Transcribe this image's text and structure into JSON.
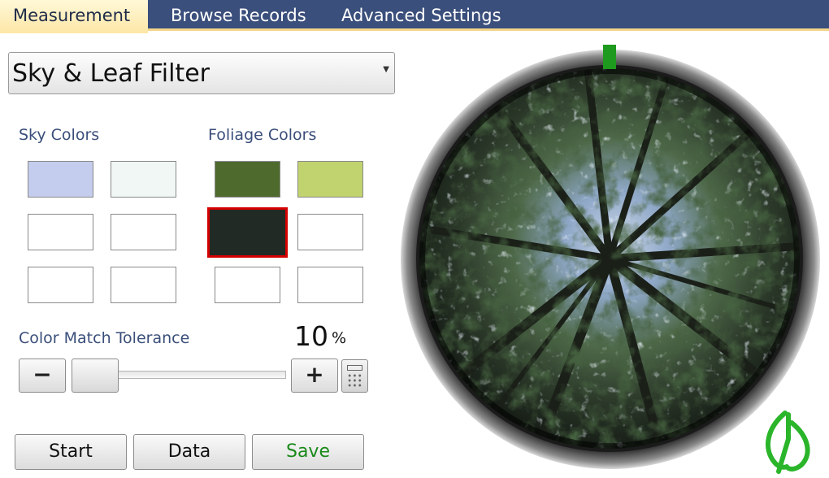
{
  "tabs": [
    {
      "label": "Measurement",
      "active": true
    },
    {
      "label": "Browse Records",
      "active": false
    },
    {
      "label": "Advanced Settings",
      "active": false
    }
  ],
  "filter": {
    "selected": "Sky & Leaf Filter"
  },
  "sky": {
    "label": "Sky Colors",
    "swatches": [
      "#c5cdee",
      "#f0f7f4",
      "#ffffff",
      "#ffffff",
      "#ffffff",
      "#ffffff"
    ]
  },
  "foliage": {
    "label": "Foliage Colors",
    "swatches": [
      "#4f6a2d",
      "#c0d36e",
      "#212a24",
      "#ffffff",
      "#ffffff",
      "#ffffff"
    ],
    "selected_index": 2
  },
  "tolerance": {
    "label": "Color Match Tolerance",
    "value": "10",
    "unit": "%",
    "fraction": 0.0,
    "minus_label": "−",
    "plus_label": "+"
  },
  "actions": {
    "start": "Start",
    "data": "Data",
    "save": "Save"
  },
  "icons": {
    "calculator": "calculator-icon",
    "logo": "leaf-logo"
  },
  "colors": {
    "tab_bar": "#3b4f7c",
    "accent": "#f3d58a",
    "save": "#1a8a1a",
    "logo": "#2ab52a",
    "marker": "#1e9a1e"
  }
}
